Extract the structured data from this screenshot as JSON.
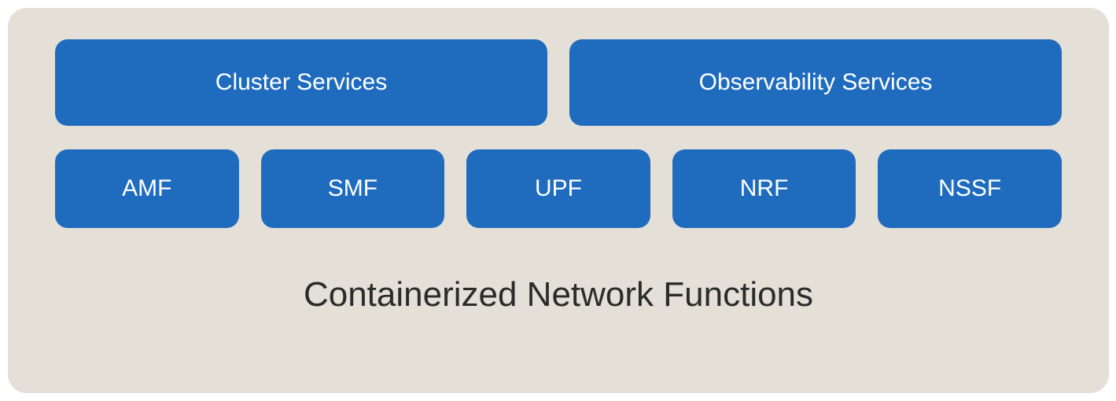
{
  "diagram": {
    "title": "Containerized Network Functions",
    "topRow": [
      {
        "label": "Cluster Services"
      },
      {
        "label": "Observability Services"
      }
    ],
    "bottomRow": [
      {
        "label": "AMF"
      },
      {
        "label": "SMF"
      },
      {
        "label": "UPF"
      },
      {
        "label": "NRF"
      },
      {
        "label": "NSSF"
      }
    ],
    "colors": {
      "boxBackground": "#1f6cbf",
      "boxText": "#ffffff",
      "containerBackground": "#e4e0d8",
      "titleText": "#2b2b2b"
    }
  }
}
